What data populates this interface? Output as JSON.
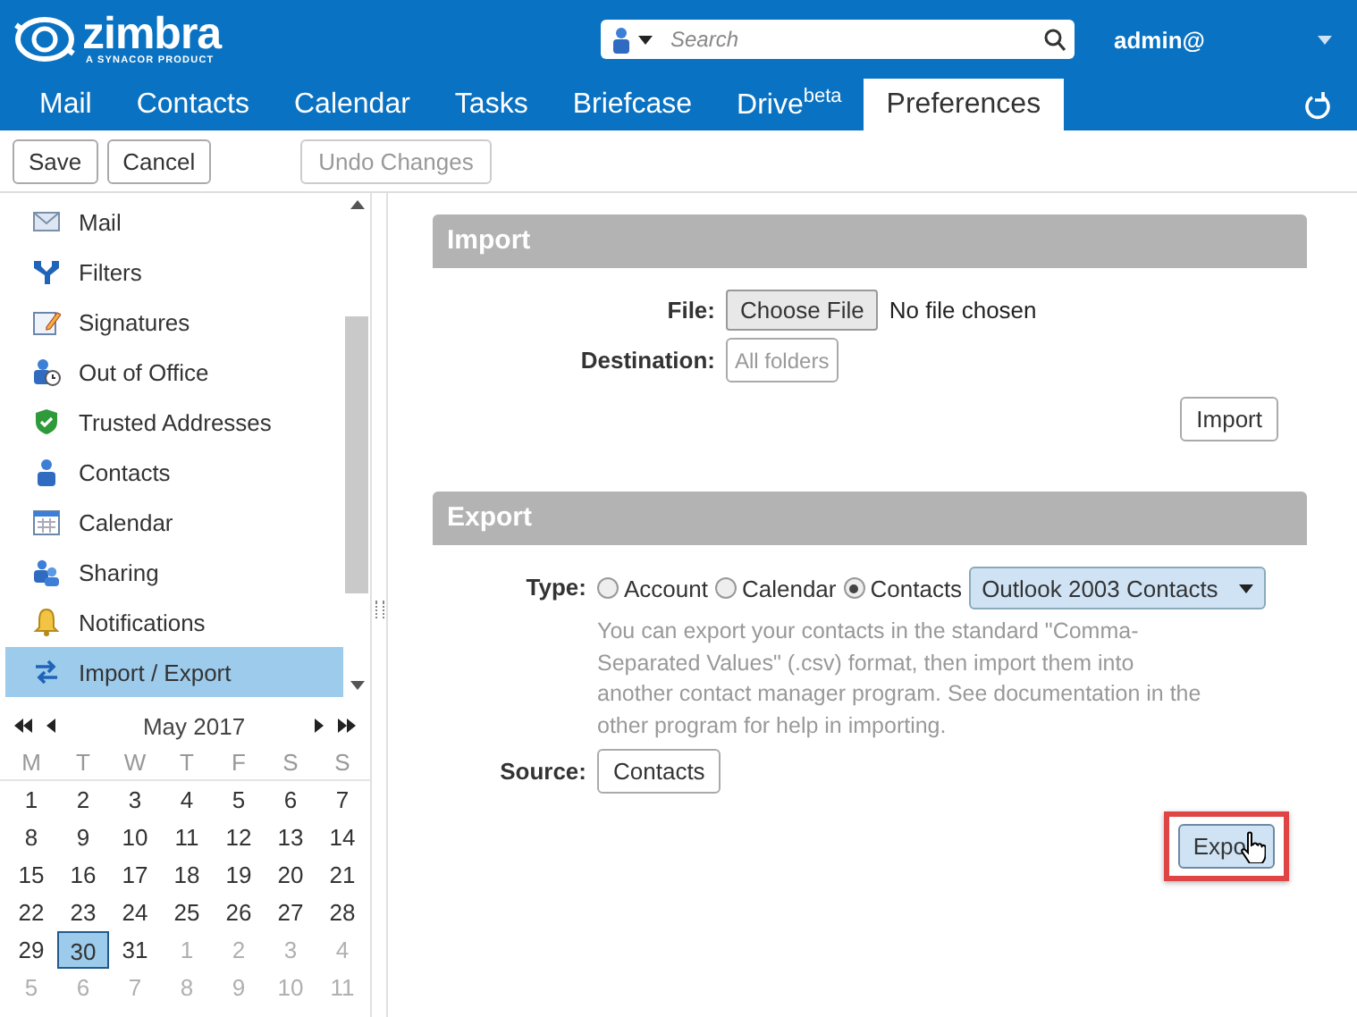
{
  "header": {
    "logo": {
      "name": "zimbra",
      "tagline": "A SYNACOR PRODUCT"
    },
    "search": {
      "placeholder": "Search"
    },
    "user": "admin@"
  },
  "tabs": [
    {
      "label": "Mail",
      "selected": false
    },
    {
      "label": "Contacts",
      "selected": false
    },
    {
      "label": "Calendar",
      "selected": false
    },
    {
      "label": "Tasks",
      "selected": false
    },
    {
      "label": "Briefcase",
      "selected": false
    },
    {
      "label": "Drive$^{beta}$",
      "selected": false
    },
    {
      "label": "Preferences",
      "selected": true
    }
  ],
  "toolbar": [
    {
      "label": "Save",
      "disabled": false
    },
    {
      "label": "Cancel",
      "disabled": false
    },
    {
      "label": "Undo Changes",
      "disabled": true
    }
  ],
  "sidebar": {
    "items": [
      {
        "label": "Mail",
        "selected": false
      },
      {
        "label": "Filters",
        "selected": false
      },
      {
        "label": "Signatures",
        "selected": false
      },
      {
        "label": "Out of Office",
        "selected": false
      },
      {
        "label": "Trusted Addresses",
        "selected": false
      },
      {
        "label": "Contacts",
        "selected": false
      },
      {
        "label": "Calendar",
        "selected": false
      },
      {
        "label": "Sharing",
        "selected": false
      },
      {
        "label": "Notifications",
        "selected": false
      },
      {
        "label": "Import / Export",
        "selected": true
      }
    ]
  },
  "calendar": {
    "month": "May 2017",
    "weekdays": [
      "M",
      "T",
      "W",
      "T",
      "F",
      "S",
      "S"
    ],
    "weeks": [
      [
        {
          "d": "1",
          "muted": false,
          "selected": false
        },
        {
          "d": "2",
          "muted": false,
          "selected": false
        },
        {
          "d": "3",
          "muted": false,
          "selected": false
        },
        {
          "d": "4",
          "muted": false,
          "selected": false
        },
        {
          "d": "5",
          "muted": false,
          "selected": false
        },
        {
          "d": "6",
          "muted": false,
          "selected": false
        },
        {
          "d": "7",
          "muted": false,
          "selected": false
        }
      ],
      [
        {
          "d": "8",
          "muted": false,
          "selected": false
        },
        {
          "d": "9",
          "muted": false,
          "selected": false
        },
        {
          "d": "10",
          "muted": false,
          "selected": false
        },
        {
          "d": "11",
          "muted": false,
          "selected": false
        },
        {
          "d": "12",
          "muted": false,
          "selected": false
        },
        {
          "d": "13",
          "muted": false,
          "selected": false
        },
        {
          "d": "14",
          "muted": false,
          "selected": false
        }
      ],
      [
        {
          "d": "15",
          "muted": false,
          "selected": false
        },
        {
          "d": "16",
          "muted": false,
          "selected": false
        },
        {
          "d": "17",
          "muted": false,
          "selected": false
        },
        {
          "d": "18",
          "muted": false,
          "selected": false
        },
        {
          "d": "19",
          "muted": false,
          "selected": false
        },
        {
          "d": "20",
          "muted": false,
          "selected": false
        },
        {
          "d": "21",
          "muted": false,
          "selected": false
        }
      ],
      [
        {
          "d": "22",
          "muted": false,
          "selected": false
        },
        {
          "d": "23",
          "muted": false,
          "selected": false
        },
        {
          "d": "24",
          "muted": false,
          "selected": false
        },
        {
          "d": "25",
          "muted": false,
          "selected": false
        },
        {
          "d": "26",
          "muted": false,
          "selected": false
        },
        {
          "d": "27",
          "muted": false,
          "selected": false
        },
        {
          "d": "28",
          "muted": false,
          "selected": false
        }
      ],
      [
        {
          "d": "29",
          "muted": false,
          "selected": false
        },
        {
          "d": "30",
          "muted": false,
          "selected": true
        },
        {
          "d": "31",
          "muted": false,
          "selected": false
        },
        {
          "d": "1",
          "muted": true,
          "selected": false
        },
        {
          "d": "2",
          "muted": true,
          "selected": false
        },
        {
          "d": "3",
          "muted": true,
          "selected": false
        },
        {
          "d": "4",
          "muted": true,
          "selected": false
        }
      ],
      [
        {
          "d": "5",
          "muted": true,
          "selected": false
        },
        {
          "d": "6",
          "muted": true,
          "selected": false
        },
        {
          "d": "7",
          "muted": true,
          "selected": false
        },
        {
          "d": "8",
          "muted": true,
          "selected": false
        },
        {
          "d": "9",
          "muted": true,
          "selected": false
        },
        {
          "d": "10",
          "muted": true,
          "selected": false
        },
        {
          "d": "11",
          "muted": true,
          "selected": false
        }
      ]
    ]
  },
  "import": {
    "title": "Import",
    "file_label": "File:",
    "file_button": "Choose File",
    "file_status": "No file chosen",
    "destination_label": "Destination:",
    "destination": "All folders",
    "button": "Import"
  },
  "export": {
    "title": "Export",
    "type_label": "Type:",
    "types": [
      {
        "label": "Account",
        "selected": false
      },
      {
        "label": "Calendar",
        "selected": false
      },
      {
        "label": "Contacts",
        "selected": true
      }
    ],
    "format": "Outlook 2003 Contacts",
    "description": "You can export your contacts in the standard \"Comma-Separated Values\" (.csv) format, then import them into another contact manager program. See documentation in the other program for help in importing.",
    "source_label": "Source:",
    "source": "Contacts",
    "button": {
      "label": "Expo",
      "highlighted": true
    }
  }
}
